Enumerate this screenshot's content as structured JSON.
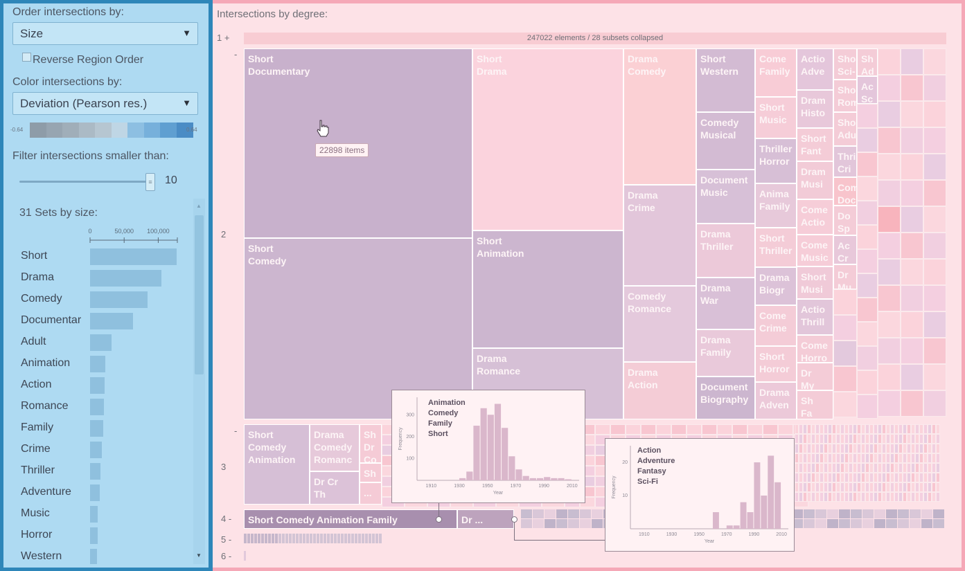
{
  "left": {
    "order_label": "Order intersections by:",
    "order_value": "Size",
    "reverse_label": "Reverse Region Order",
    "color_label": "Color intersections by:",
    "color_value": "Deviation (Pearson res.)",
    "scale_min": "-0.64",
    "scale_max": "0.64",
    "scale_colors": [
      "#8e9ca8",
      "#97a5b1",
      "#a0aeb9",
      "#abbac5",
      "#b6c6d1",
      "#bfd6e5",
      "#8dbfe2",
      "#77b0db",
      "#5f9fd1",
      "#4a8cc5"
    ],
    "filter_label": "Filter intersections smaller than:",
    "filter_value": "10",
    "filter_fraction": 1.0,
    "sets_title": "31 Sets by size:",
    "axis_ticks": [
      "0",
      "50,000",
      "100,000"
    ],
    "sets": [
      {
        "name": "Short",
        "size": 127000
      },
      {
        "name": "Drama",
        "size": 105000
      },
      {
        "name": "Comedy",
        "size": 84000
      },
      {
        "name": "Documentar",
        "size": 63000
      },
      {
        "name": "Adult",
        "size": 31000
      },
      {
        "name": "Animation",
        "size": 22000
      },
      {
        "name": "Action",
        "size": 21000
      },
      {
        "name": "Romance",
        "size": 20000
      },
      {
        "name": "Family",
        "size": 19000
      },
      {
        "name": "Crime",
        "size": 17000
      },
      {
        "name": "Thriller",
        "size": 15000
      },
      {
        "name": "Adventure",
        "size": 14000
      },
      {
        "name": "Music",
        "size": 11000
      },
      {
        "name": "Horror",
        "size": 11000
      },
      {
        "name": "Western",
        "size": 10000
      }
    ]
  },
  "main": {
    "title": "Intersections by degree:",
    "degrees": [
      {
        "label": "1 +"
      },
      {
        "label": "-"
      },
      {
        "label": "2"
      },
      {
        "label": "-"
      },
      {
        "label": "3"
      },
      {
        "label": "4 -"
      },
      {
        "label": "5 -"
      },
      {
        "label": "6 -"
      }
    ],
    "collapsed_text": "247022 elements / 28 subsets collapsed",
    "tooltip": "22898 items",
    "degree2_cells": [
      {
        "label": "Short\nDocumentary",
        "color": "#c8b1cc"
      },
      {
        "label": "Short\nComedy",
        "color": "#ccb6cf"
      },
      {
        "label": "Short\nDrama",
        "color": "#fbd3dd"
      },
      {
        "label": "Short\nAnimation",
        "color": "#ccb6cf"
      },
      {
        "label": "Drama\nRomance",
        "color": "#d6c0d6"
      },
      {
        "label": "Drama\nComedy",
        "color": "#fbd0d4"
      },
      {
        "label": "Drama\nCrime",
        "color": "#e2c6da"
      },
      {
        "label": "Comedy\nRomance",
        "color": "#e4c9dc"
      },
      {
        "label": "Drama\nAction",
        "color": "#f4ccd6"
      },
      {
        "label": "Short\nWestern",
        "color": "#d3bbd3"
      },
      {
        "label": "Comedy\nMusical",
        "color": "#d3bbd3"
      },
      {
        "label": "Document\nMusic",
        "color": "#d7c0d7"
      },
      {
        "label": "Drama\nThriller",
        "color": "#ecc9d9"
      },
      {
        "label": "Drama\nWar",
        "color": "#d9c0d7"
      },
      {
        "label": "Drama\nFamily",
        "color": "#e9c9da"
      },
      {
        "label": "Document\nBiography",
        "color": "#ccb6cf"
      },
      {
        "label": "Come\nFamily",
        "color": "#f8ccd6"
      },
      {
        "label": "Short\nMusic",
        "color": "#f6cdd8"
      },
      {
        "label": "Thriller\nHorror",
        "color": "#d7bfd6"
      },
      {
        "label": "Anima\nFamily",
        "color": "#e7c9da"
      },
      {
        "label": "Short\nThriller",
        "color": "#f4ccd7"
      },
      {
        "label": "Drama\nBiogr",
        "color": "#dcc2d8"
      },
      {
        "label": "Come\nCrime",
        "color": "#f4ccd7"
      },
      {
        "label": "Short\nHorror",
        "color": "#f4ccd7"
      },
      {
        "label": "Drama\nAdven",
        "color": "#ecc9d9"
      },
      {
        "label": "Actio\nAdve",
        "color": "#e4c6db"
      },
      {
        "label": "Dram\nHisto",
        "color": "#e8c8da"
      },
      {
        "label": "Short\nFant",
        "color": "#f4ccd7"
      },
      {
        "label": "Dram\nMusi",
        "color": "#f2cbd7"
      },
      {
        "label": "Come\nActio",
        "color": "#f6cdd8"
      },
      {
        "label": "Come\nMusic",
        "color": "#f6cdd8"
      },
      {
        "label": "Short\nMusi",
        "color": "#f0cad8"
      },
      {
        "label": "Actio\nThrill",
        "color": "#e2c6da"
      },
      {
        "label": "Come\nHorro",
        "color": "#f4ccd7"
      },
      {
        "label": "Dr\nMy",
        "color": "#f4ccd7"
      },
      {
        "label": "Sh\nFa",
        "color": "#f4ccd7"
      },
      {
        "label": "Shor\nSci-",
        "color": "#f4ccd7"
      },
      {
        "label": "Shor\nRom",
        "color": "#f4ccd7"
      },
      {
        "label": "Shor\nAdul",
        "color": "#f4ccd7"
      },
      {
        "label": "Thri\nCri",
        "color": "#e2c6da"
      },
      {
        "label": "Com\nDoc",
        "color": "#f8c4cc"
      },
      {
        "label": "Do\nSp",
        "color": "#f4ccd7"
      },
      {
        "label": "Ac\nCr",
        "color": "#e8c8da"
      },
      {
        "label": "Dr\nMu",
        "color": "#f4ccd7"
      },
      {
        "label": "Sh\nAd",
        "color": "#f4ccd7"
      },
      {
        "label": "Ac\nSc",
        "color": "#e4c6db"
      }
    ],
    "degree3_cells": [
      {
        "label": "Short\nComedy\nAnimation",
        "color": "#d6bfd6"
      },
      {
        "label": "Drama\nComedy\nRomanc",
        "color": "#e6c9da"
      },
      {
        "label": "Dr Cr\nTh",
        "color": "#dcc2d8"
      },
      {
        "label": "Sh\nDr\nCo",
        "color": "#f5cbd6"
      },
      {
        "label": "Sh",
        "color": "#f5cbd6"
      },
      {
        "label": "...",
        "color": "#f5cbd6"
      }
    ],
    "degree4_cells": [
      {
        "label": "Short Comedy Animation Family",
        "color": "#a88fae"
      },
      {
        "label": "Dr ...",
        "color": "#bda3bd"
      }
    ],
    "popups": [
      {
        "sets": [
          "Animation",
          "Comedy",
          "Family",
          "Short"
        ],
        "y_ticks": [
          "300",
          "200",
          "100"
        ],
        "y_label": "Frequency",
        "x_ticks": [
          "1910",
          "1930",
          "1950",
          "1970",
          "1990",
          "2010"
        ],
        "x_label": "Year",
        "years": [
          1910,
          1915,
          1920,
          1925,
          1930,
          1935,
          1940,
          1945,
          1950,
          1955,
          1960,
          1965,
          1970,
          1975,
          1980,
          1985,
          1990,
          1995,
          2000,
          2005
        ],
        "freq": [
          0,
          0,
          0,
          0,
          10,
          40,
          250,
          330,
          300,
          350,
          240,
          110,
          50,
          20,
          10,
          10,
          15,
          10,
          10,
          5
        ],
        "y_max": 380
      },
      {
        "sets": [
          "Action",
          "Adventure",
          "Fantasy",
          "Sci-Fi"
        ],
        "y_ticks": [
          "20",
          "10"
        ],
        "y_label": "Frequency",
        "x_ticks": [
          "1910",
          "1930",
          "1950",
          "1970",
          "1990",
          "2010"
        ],
        "x_label": "Year",
        "years": [
          1910,
          1915,
          1920,
          1925,
          1930,
          1935,
          1940,
          1945,
          1950,
          1955,
          1960,
          1965,
          1970,
          1975,
          1980,
          1985,
          1990,
          1995,
          2000,
          2005
        ],
        "freq": [
          0,
          0,
          0,
          0,
          0,
          0,
          0,
          0,
          0,
          0,
          5,
          0,
          1,
          1,
          8,
          5,
          20,
          10,
          22,
          14
        ],
        "y_max": 25
      }
    ]
  }
}
